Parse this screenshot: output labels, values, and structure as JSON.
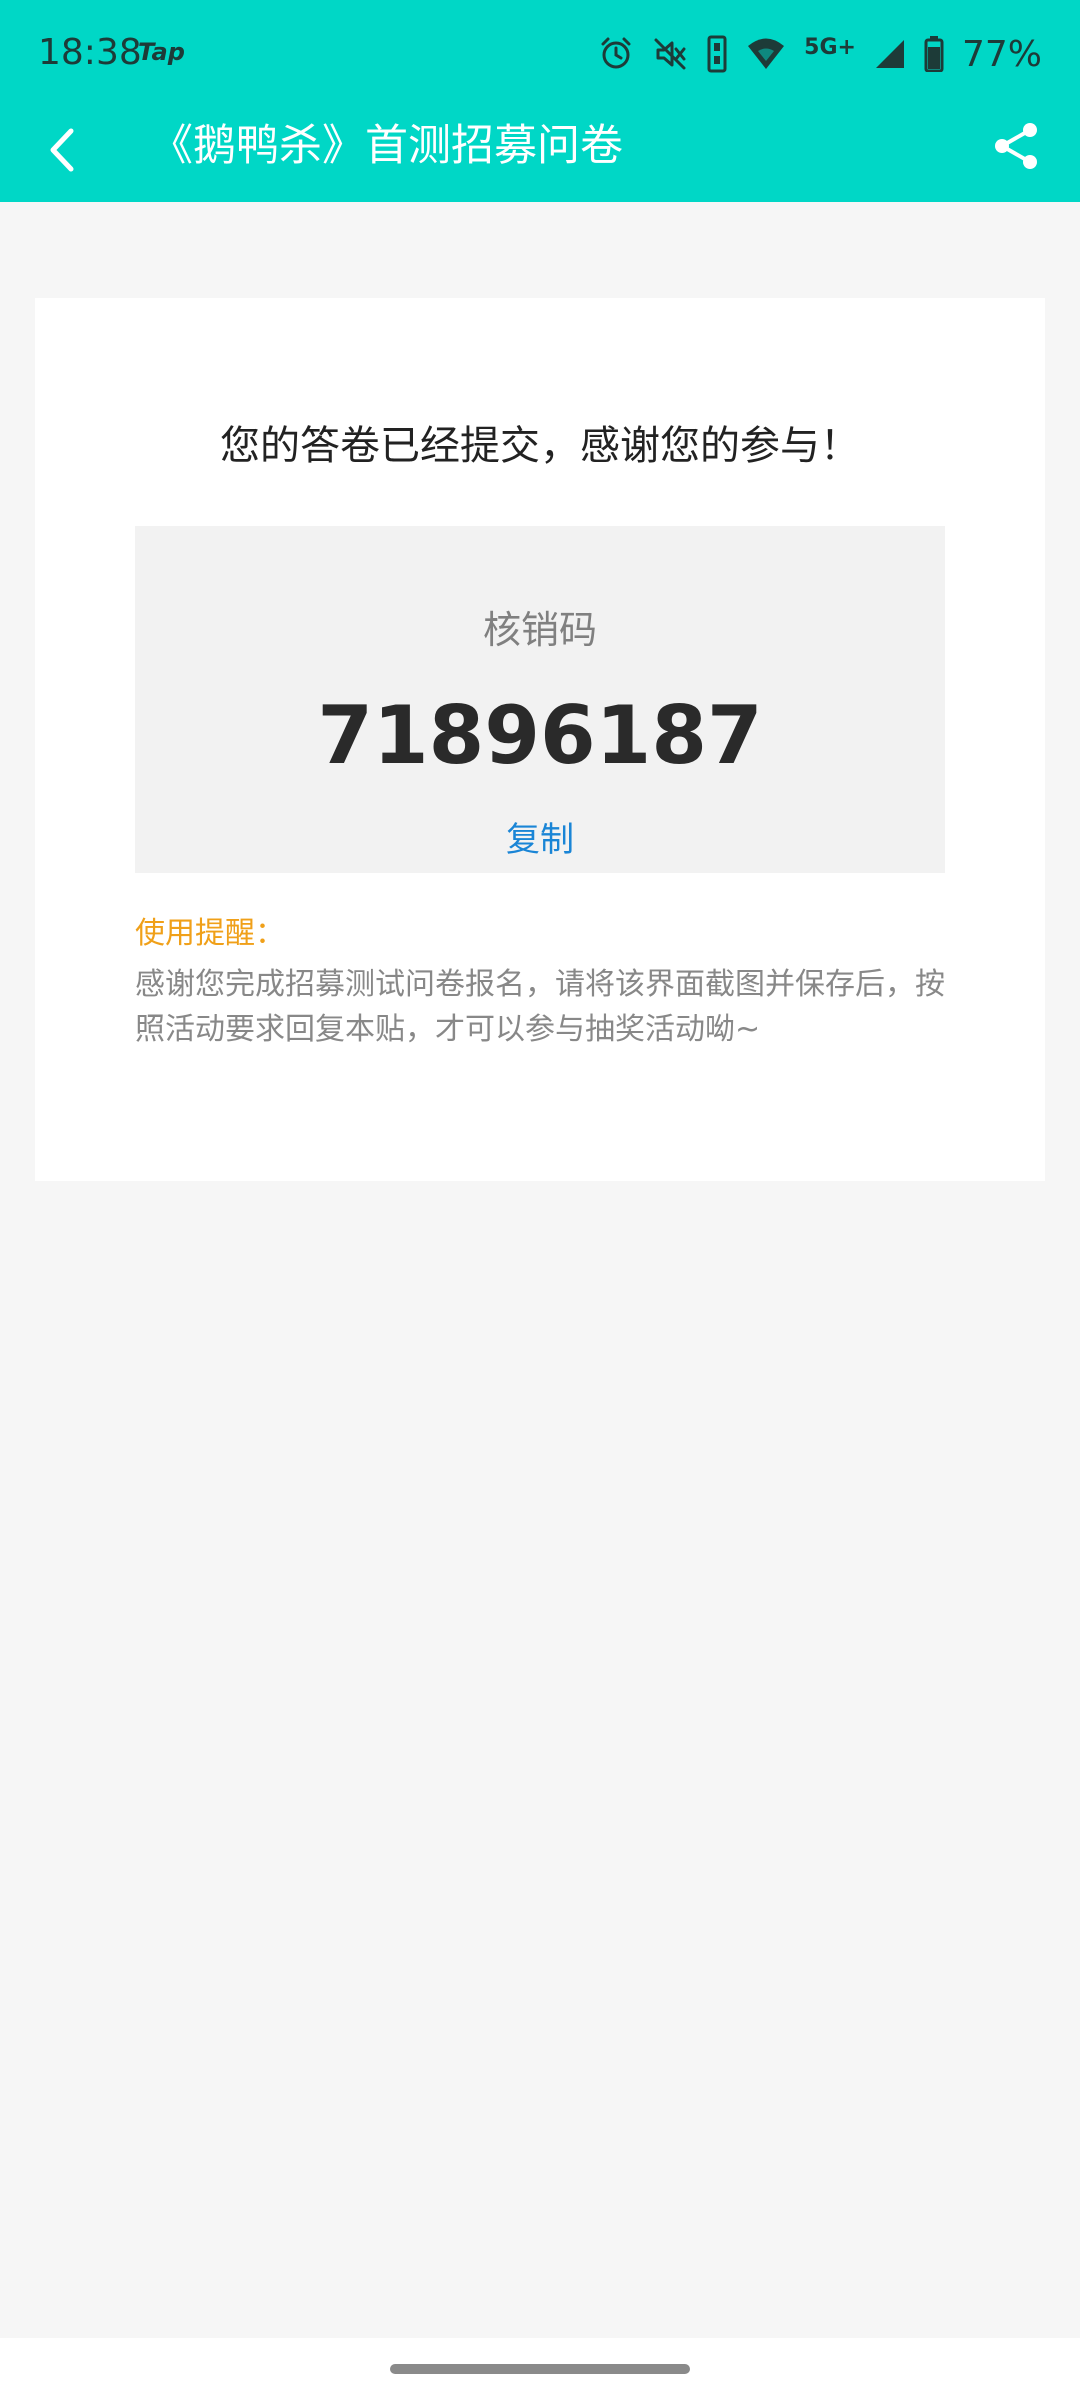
{
  "status_bar": {
    "time": "18:38",
    "app_badge": "Tap",
    "network": "5G+",
    "battery": "77%",
    "icons": [
      "alarm-icon",
      "mute-icon",
      "vibrate-icon",
      "wifi-icon",
      "signal-icon",
      "battery-icon"
    ]
  },
  "header": {
    "title": "《鹅鸭杀》首测招募问卷",
    "back_icon": "chevron-left-icon",
    "share_icon": "share-icon"
  },
  "result": {
    "thanks_message": "您的答卷已经提交，感谢您的参与！",
    "code_label": "核销码",
    "code_value": "71896187",
    "copy_label": "复制"
  },
  "tip": {
    "title": "使用提醒：",
    "body": "感谢您完成招募测试问卷报名，请将该界面截图并保存后，按照活动要求回复本贴，才可以参与抽奖活动呦~"
  },
  "colors": {
    "header_bg": "#00d7c6",
    "copy_link": "#1a85d6",
    "tip_title": "#f0a019"
  }
}
